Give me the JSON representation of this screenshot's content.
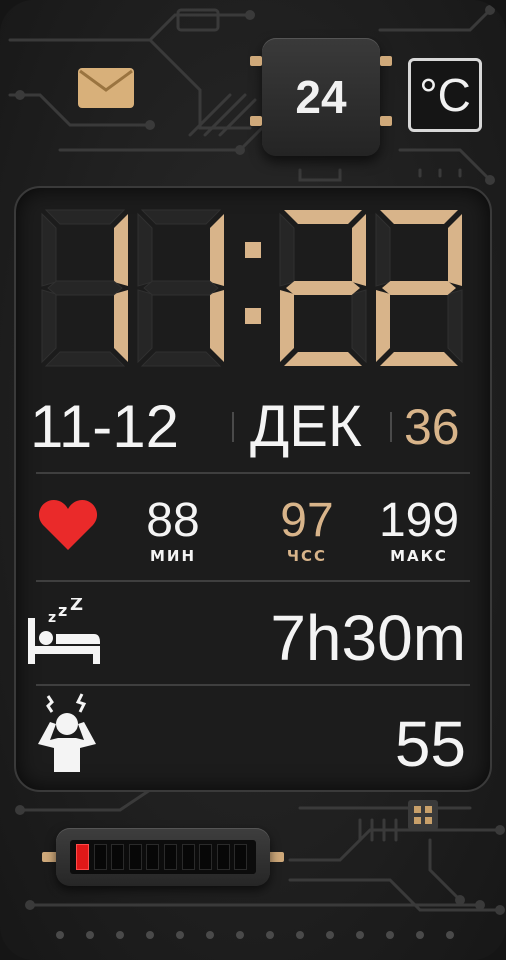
{
  "colors": {
    "accent": "#d8b48a",
    "heart": "#ea2a2a",
    "battery_low": "#e01818",
    "text": "#f4f4f4"
  },
  "header": {
    "mail_icon": "envelope-icon",
    "temperature": "24",
    "temperature_unit": "°C"
  },
  "clock": {
    "hours": "11",
    "minutes": "22",
    "separator": ":"
  },
  "date": {
    "day_month": "11-12",
    "month_name": "ДЕК",
    "week_number": "36"
  },
  "heart_rate": {
    "icon": "heart-icon",
    "min_value": "88",
    "min_label": "МИН",
    "current_value": "97",
    "current_label": "ЧСС",
    "max_value": "199",
    "max_label": "МАКС"
  },
  "sleep": {
    "icon": "sleep-bed-icon",
    "value": "7h30m"
  },
  "stress": {
    "icon": "stressed-person-icon",
    "value": "55"
  },
  "battery": {
    "level_fraction": 0.1,
    "segments": 10
  }
}
